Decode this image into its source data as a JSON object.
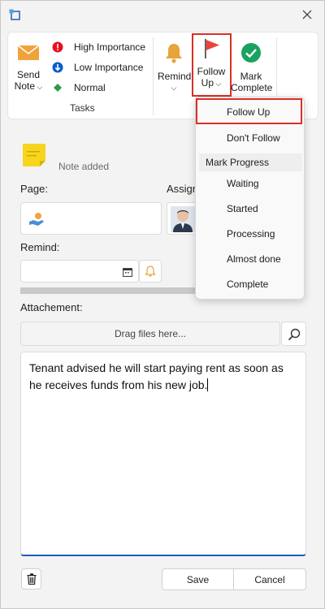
{
  "ribbon": {
    "send_note": "Send",
    "send_note_2": "Note",
    "high_importance": "High Importance",
    "low_importance": "Low Importance",
    "normal": "Normal",
    "group_tasks": "Tasks",
    "remind": "Remind",
    "follow_up_1": "Follow",
    "follow_up_2": "Up",
    "mark_complete_1": "Mark",
    "mark_complete_2": "Complete"
  },
  "note": {
    "status": "Note added"
  },
  "form": {
    "page_label": "Page:",
    "assign_label": "Assign",
    "remind_label": "Remind:",
    "remind_value": "",
    "attachment_label": "Attachement:",
    "drag_placeholder": "Drag files here...",
    "body_text": "Tenant advised he will start paying rent as soon as he receives funds from his new job."
  },
  "footer": {
    "save": "Save",
    "cancel": "Cancel"
  },
  "dropdown": {
    "follow_up": "Follow Up",
    "dont_follow": "Don't Follow",
    "mark_progress": "Mark Progress",
    "waiting": "Waiting",
    "started": "Started",
    "processing": "Processing",
    "almost_done": "Almost done",
    "complete": "Complete"
  },
  "colors": {
    "accent": "#1a5fb4",
    "highlight_border": "#d93025",
    "importance_high": "#e81123",
    "importance_low": "#0a5ccf",
    "normal": "#2e9b4a",
    "flag": "#e8453c",
    "check": "#1aa260",
    "bell": "#e8a33a"
  }
}
